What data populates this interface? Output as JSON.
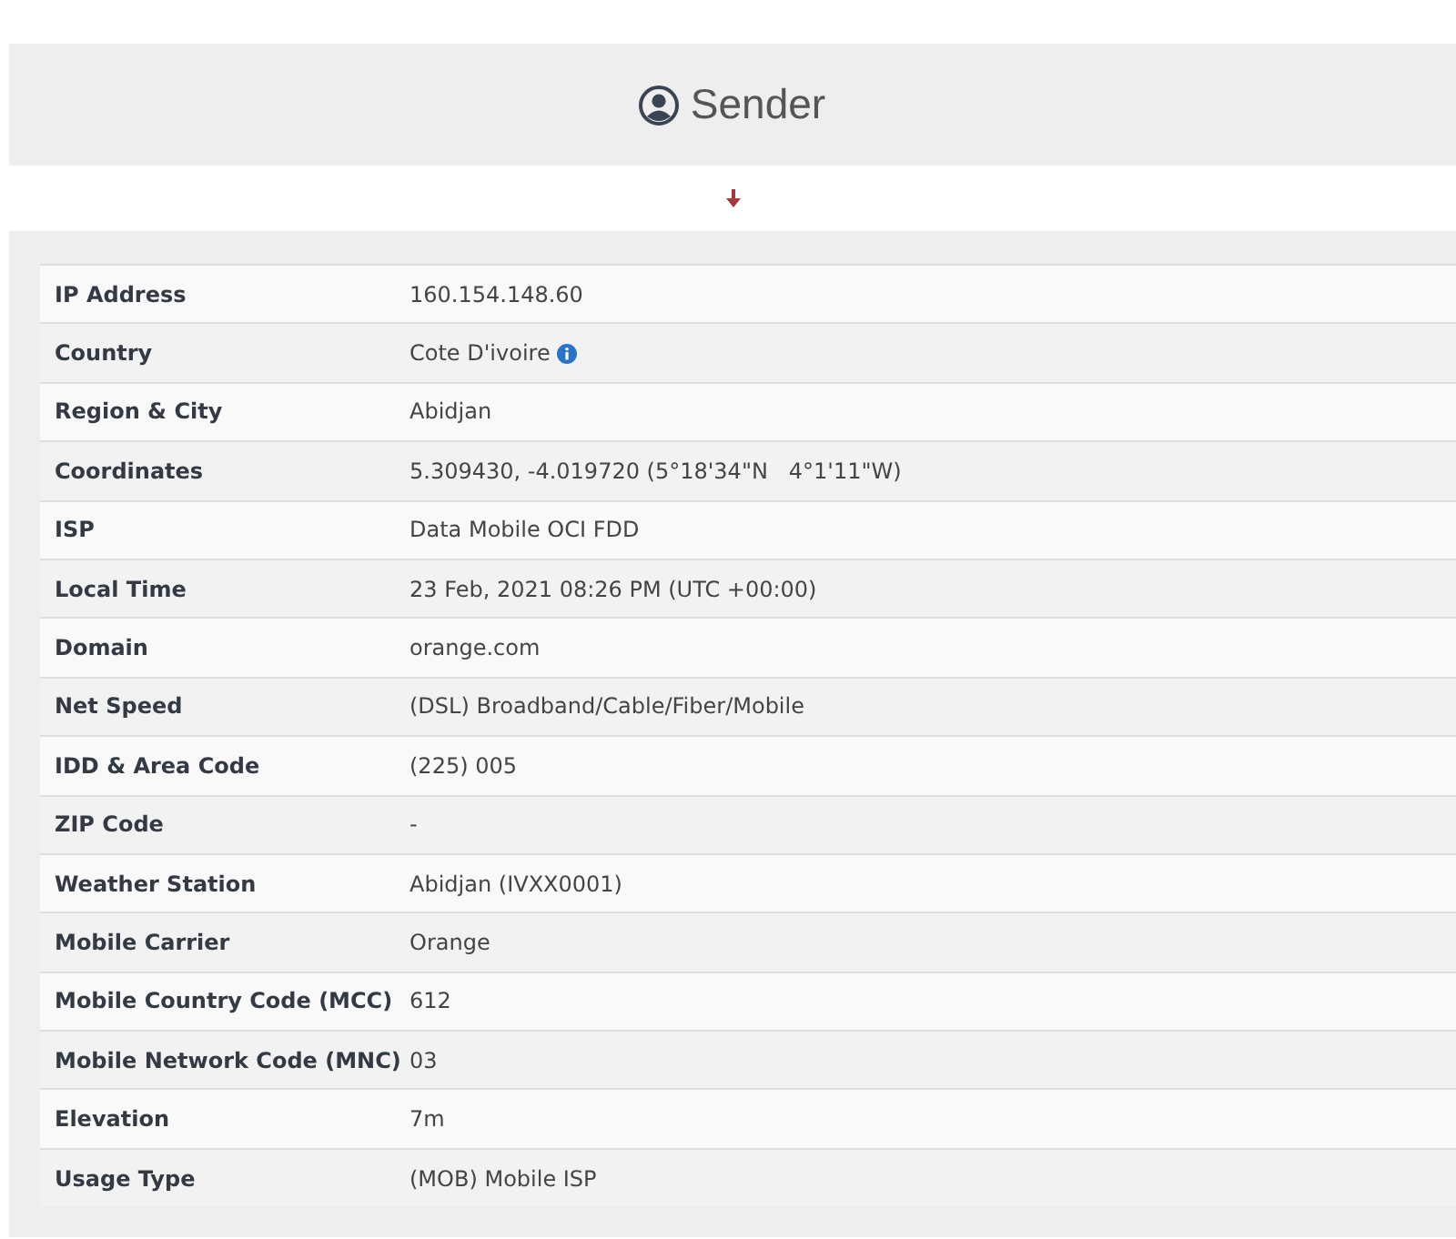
{
  "header": {
    "title": "Sender"
  },
  "rows": [
    {
      "label": "IP Address",
      "value": "160.154.148.60",
      "info": false
    },
    {
      "label": "Country",
      "value": "Cote D'ivoire",
      "info": true
    },
    {
      "label": "Region & City",
      "value": "Abidjan",
      "info": false
    },
    {
      "label": "Coordinates",
      "value": "5.309430, -4.019720 (5°18'34\"N   4°1'11\"W)",
      "info": false
    },
    {
      "label": "ISP",
      "value": "Data Mobile OCI FDD",
      "info": false
    },
    {
      "label": "Local Time",
      "value": "23 Feb, 2021 08:26 PM (UTC +00:00)",
      "info": false
    },
    {
      "label": "Domain",
      "value": "orange.com",
      "info": false
    },
    {
      "label": "Net Speed",
      "value": "(DSL) Broadband/Cable/Fiber/Mobile",
      "info": false
    },
    {
      "label": "IDD & Area Code",
      "value": "(225) 005",
      "info": false
    },
    {
      "label": "ZIP Code",
      "value": "-",
      "info": false
    },
    {
      "label": "Weather Station",
      "value": "Abidjan (IVXX0001)",
      "info": false
    },
    {
      "label": "Mobile Carrier",
      "value": "Orange",
      "info": false
    },
    {
      "label": "Mobile Country Code (MCC)",
      "value": "612",
      "info": false
    },
    {
      "label": "Mobile Network Code (MNC)",
      "value": "03",
      "info": false
    },
    {
      "label": "Elevation",
      "value": "7m",
      "info": false
    },
    {
      "label": "Usage Type",
      "value": "(MOB) Mobile ISP",
      "info": false
    }
  ]
}
